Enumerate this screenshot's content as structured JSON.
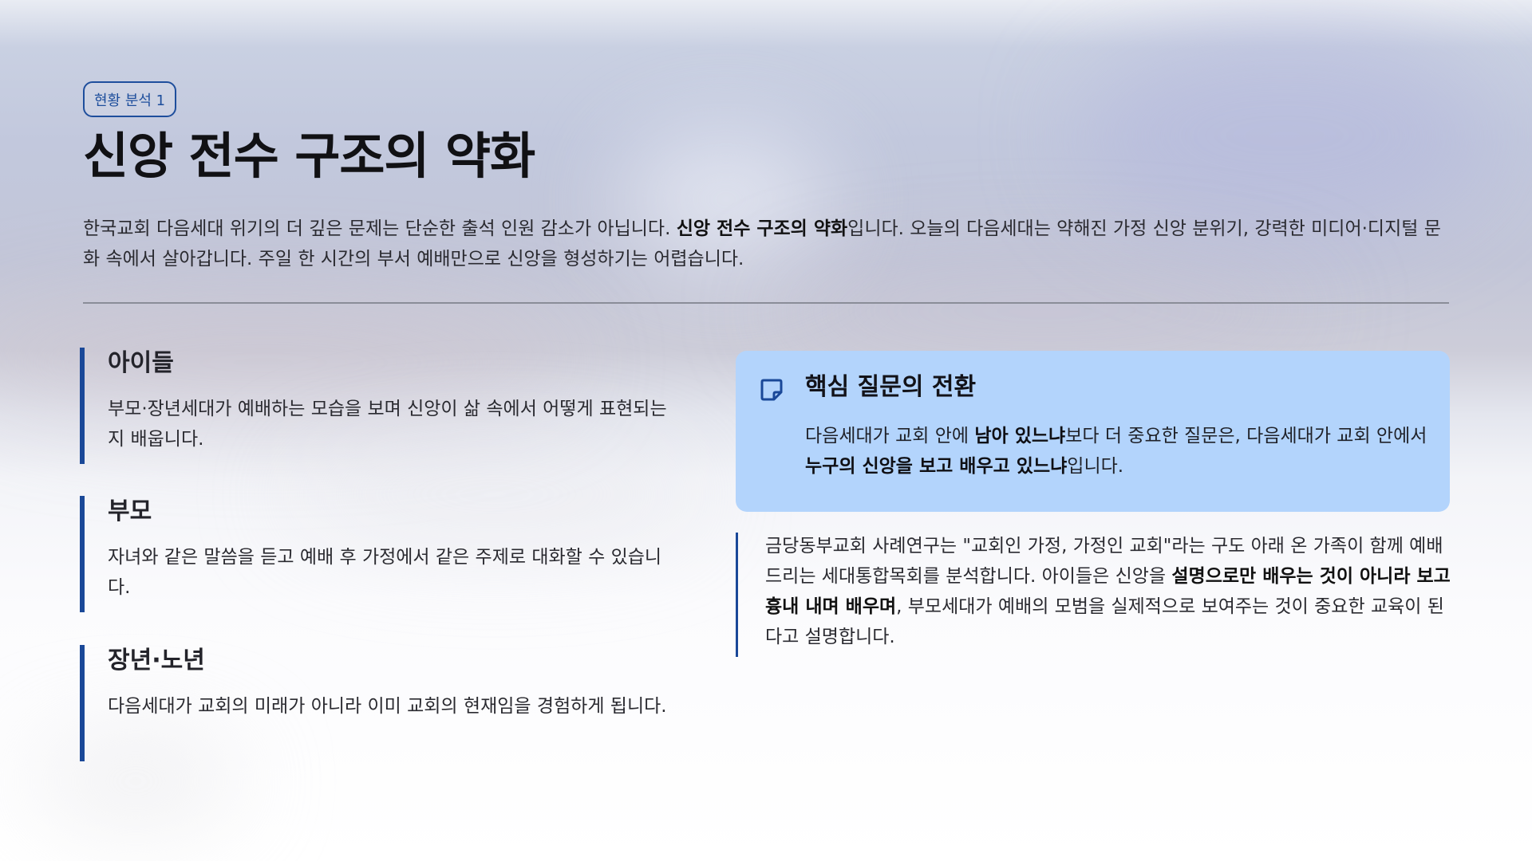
{
  "badge": "현황 분석 1",
  "title": "신앙 전수 구조의 약화",
  "lead": {
    "part1": "한국교회 다음세대 위기의 더 깊은 문제는 단순한 출석 인원 감소가 아닙니다. ",
    "bold": "신앙 전수 구조의 약화",
    "part2": "입니다. 오늘의 다음세대는 약해진 가정 신앙 분위기, 강력한 미디어·디지털 문화 속에서 살아갑니다. 주일 한 시간의 부서 예배만으로 신앙을 형성하기는 어렵습니다."
  },
  "groups": [
    {
      "title": "아이들",
      "text": "부모·장년세대가 예배하는 모습을 보며 신앙이 삶 속에서 어떻게 표현되는지 배웁니다."
    },
    {
      "title": "부모",
      "text": "자녀와 같은 말씀을 듣고 예배 후 가정에서 같은 주제로 대화할 수 있습니다."
    },
    {
      "title": "장년·노년",
      "text": "다음세대가 교회의 미래가 아니라 이미 교회의 현재임을 경험하게 됩니다."
    }
  ],
  "callout": {
    "icon": "sticky-note-icon",
    "title": "핵심 질문의 전환",
    "t1": "다음세대가 교회 안에 ",
    "b1": "남아 있느냐",
    "t2": "보다 더 중요한 질문은, 다음세대가 교회 안에서 ",
    "b2": "누구의 신앙을 보고 배우고 있느냐",
    "t3": "입니다."
  },
  "quote": {
    "t1": "금당동부교회 사례연구는 \"교회인 가정, 가정인 교회\"라는 구도 아래 온 가족이 함께 예배드리는 세대통합목회를 분석합니다. 아이들은 신앙을 ",
    "b1": "설명으로만 배우는 것이 아니라 보고 흉내 내며 배우며",
    "t2": ", 부모세대가 예배의 모범을 실제적으로 보여주는 것이 중요한 교육이 된다고 설명합니다."
  },
  "colors": {
    "accent": "#1a4898",
    "callout_bg": "#b3d4fc",
    "badge": "#1e4e9c"
  }
}
